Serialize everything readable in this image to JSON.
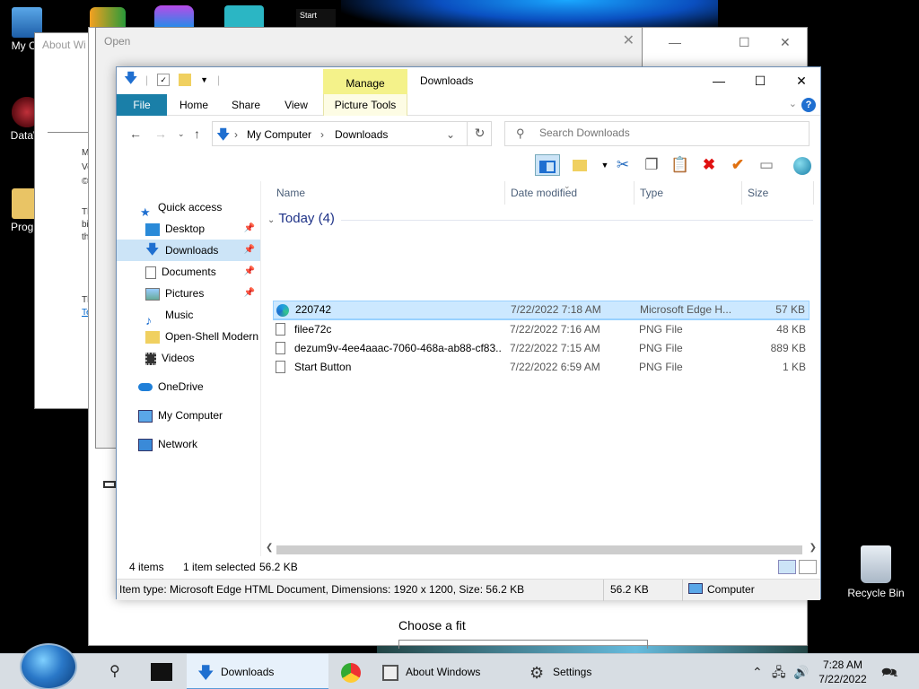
{
  "desktop": {
    "icons": [
      {
        "label": "My Co"
      },
      {
        "label": "DataW"
      },
      {
        "label": "Progra"
      }
    ],
    "top_apps": [
      {
        "label": "Start"
      }
    ],
    "recycle_bin": {
      "label": "Recycle Bin"
    }
  },
  "about_window": {
    "title": "About Wi",
    "frag1": "M",
    "frag2": "Ve",
    "frag3": "©",
    "frag4": "Th",
    "frag5": "bi",
    "frag6": "th",
    "frag7": "Th",
    "link": "Te"
  },
  "open_dialog": {
    "title": "Open"
  },
  "settings_window": {
    "choose_fit": "Choose a fit"
  },
  "explorer": {
    "title": "Downloads",
    "manage_tab": "Manage",
    "ribbon_tabs": {
      "file": "File",
      "home": "Home",
      "share": "Share",
      "view": "View",
      "picture_tools": "Picture Tools"
    },
    "address": {
      "crumbs": [
        "My Computer",
        "Downloads"
      ]
    },
    "search": {
      "placeholder": "Search Downloads"
    },
    "nav": {
      "quick_access": "Quick access",
      "items": [
        {
          "label": "Desktop"
        },
        {
          "label": "Downloads"
        },
        {
          "label": "Documents"
        },
        {
          "label": "Pictures"
        },
        {
          "label": "Music"
        },
        {
          "label": "Open-Shell Modern"
        },
        {
          "label": "Videos"
        }
      ],
      "onedrive": "OneDrive",
      "my_computer": "My Computer",
      "network": "Network"
    },
    "columns": {
      "name": "Name",
      "date": "Date modified",
      "type": "Type",
      "size": "Size"
    },
    "group_label": "Today (4)",
    "files": [
      {
        "name": "220742",
        "date": "7/22/2022 7:18 AM",
        "type": "Microsoft Edge H...",
        "size": "57 KB",
        "selected": true
      },
      {
        "name": "filee72c",
        "date": "7/22/2022 7:16 AM",
        "type": "PNG File",
        "size": "48 KB",
        "selected": false
      },
      {
        "name": "dezum9v-4ee4aaac-7060-468a-ab88-cf83...",
        "date": "7/22/2022 7:15 AM",
        "type": "PNG File",
        "size": "889 KB",
        "selected": false
      },
      {
        "name": "Start Button",
        "date": "7/22/2022 6:59 AM",
        "type": "PNG File",
        "size": "1 KB",
        "selected": false
      }
    ],
    "status": {
      "items": "4 items",
      "selected": "1 item selected",
      "size": "56.2 KB"
    },
    "details": {
      "info": "Item type: Microsoft Edge HTML Document, Dimensions: 1920 x 1200, Size: 56.2 KB",
      "size": "56.2 KB",
      "location": "Computer"
    }
  },
  "taskbar": {
    "items": [
      {
        "label": "Downloads"
      },
      {
        "label": "About Windows"
      },
      {
        "label": "Settings"
      }
    ],
    "clock": {
      "time": "7:28 AM",
      "date": "7/22/2022"
    },
    "notification_count": "1"
  },
  "colors": {
    "file_tab": "#1a7fa8",
    "manage_tab": "#f4f28a",
    "selection": "#cce8ff",
    "accent_blue": "#1f6fd0",
    "delete_red": "#e01010",
    "check_orange": "#e07010"
  }
}
